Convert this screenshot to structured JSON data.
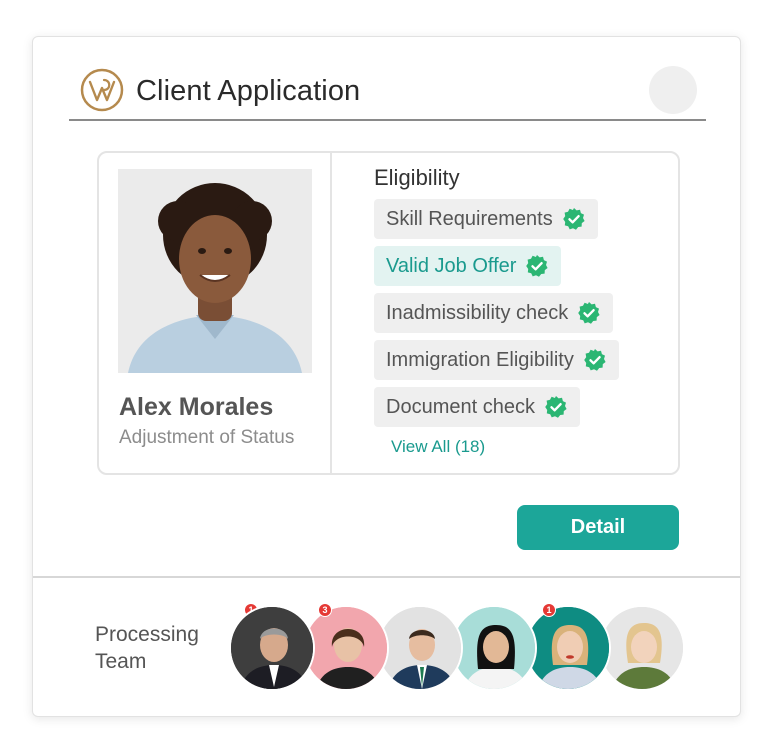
{
  "header": {
    "title": "Client Application"
  },
  "client": {
    "name": "Alex Morales",
    "status": "Adjustment of Status"
  },
  "eligibility": {
    "title": "Eligibility",
    "items": [
      {
        "label": "Skill Requirements",
        "checked": true,
        "active": false
      },
      {
        "label": "Valid Job Offer",
        "checked": true,
        "active": true
      },
      {
        "label": "Inadmissibility check",
        "checked": true,
        "active": false
      },
      {
        "label": "Immigration Eligibility",
        "checked": true,
        "active": false
      },
      {
        "label": "Document check",
        "checked": true,
        "active": false
      }
    ],
    "view_all_label": "View All (18)"
  },
  "actions": {
    "detail_label": "Detail"
  },
  "team": {
    "label_line1": "Processing",
    "label_line2": "Team",
    "members": [
      {
        "badge": "1",
        "bg": "#3a3a3a"
      },
      {
        "badge": "3",
        "bg": "#f3a7ae"
      },
      {
        "badge": "",
        "bg": "#dcdcdc"
      },
      {
        "badge": "",
        "bg": "#a7dcd7"
      },
      {
        "badge": "1",
        "bg": "#0f8c82"
      },
      {
        "badge": "",
        "bg": "#e4e4e4"
      }
    ]
  },
  "colors": {
    "accent": "#1ca699",
    "check_green": "#2bb673",
    "badge_red": "#e53935",
    "logo_gold": "#b58a4e"
  }
}
